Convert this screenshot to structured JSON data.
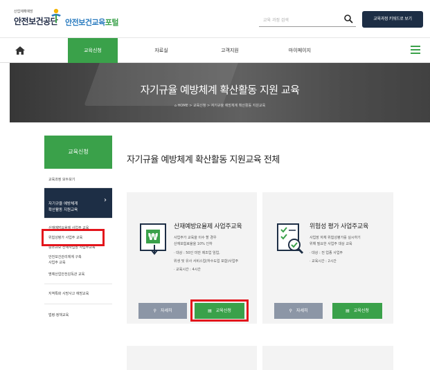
{
  "header": {
    "org_small": "산업재해예방",
    "org_name": "안전보건공단",
    "portal_blue": "안전보건교육",
    "portal_green": "포털",
    "search_placeholder": "교육 과정 검색",
    "keyword_button": "교육과정 키워드로 보기"
  },
  "nav": {
    "items": [
      "교육신청",
      "자료실",
      "고객지원",
      "마이페이지"
    ]
  },
  "banner": {
    "title": "자기규율 예방체계 확산활동 지원 교육",
    "breadcrumb": "HOME  >  교육신청  >  자기규율 예방체계 확산활동 지원교육"
  },
  "sidebar": {
    "head": "교육신청",
    "items": [
      "교육과정 모두보기",
      "자기규율 예방체계\n확산활동 지원교육",
      "산재예방요율제 사업주 교육",
      "위험성평가 사업주 교육",
      "중소규모 산재사업장 사업주교육",
      "안전보건관리체계 구축\n사업주 교육",
      "명예산업안전감독관 교육",
      "지역특화 사망사고 예방교육",
      "법령·정책교육"
    ]
  },
  "main": {
    "title": "자기규율 예방체계 확산활동 지원교육 전체",
    "cards": [
      {
        "name": "산재예방요율제 사업주교육",
        "lines": [
          "사업주가 교육을 이수 할 경우",
          "산재보험료율을 10% 인하",
          "· 대상 : 50인 미만 제조업 임업,",
          "위생 및 유사 서비스업(하수도업 포함)사업주",
          "· 교육시간 : 4시간"
        ],
        "detail": "자세히",
        "apply": "교육신청"
      },
      {
        "name": "위험성 평가 사업주교육",
        "lines": [
          "사업장 자체 위험성평가를 실시하기",
          "위해 필요한 사업주 대상 교육",
          "· 대상 : 전 업종 사업주",
          "· 교육시간 : 2시간"
        ],
        "detail": "자세히",
        "apply": "교육신청"
      }
    ]
  },
  "colors": {
    "green": "#3aa14a",
    "navy": "#1d2e45",
    "highlight": "#e3141b"
  }
}
